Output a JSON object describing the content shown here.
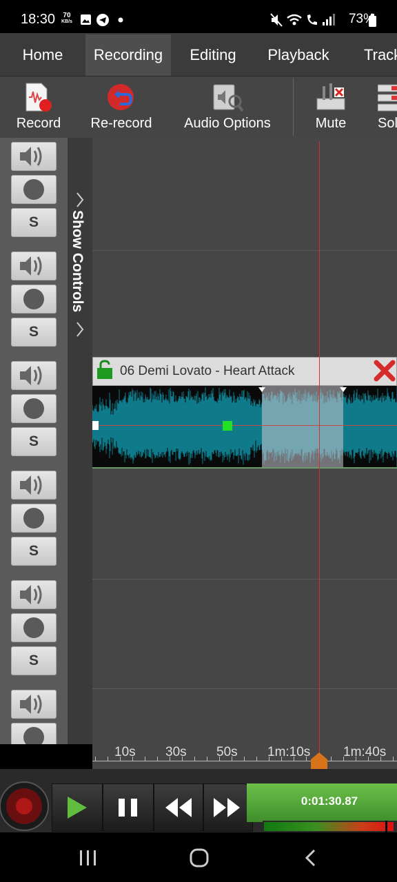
{
  "status_bar": {
    "time": "18:30",
    "speed_value": "70",
    "speed_unit": "KB/s",
    "battery": "73%",
    "icons": [
      "gallery-icon",
      "telegram-icon",
      "dot-icon",
      "mute-icon",
      "wifi-icon",
      "call-icon",
      "signal-icon",
      "battery-icon"
    ]
  },
  "tabs": [
    {
      "label": "Home",
      "active": false
    },
    {
      "label": "Recording",
      "active": true
    },
    {
      "label": "Editing",
      "active": false
    },
    {
      "label": "Playback",
      "active": false
    },
    {
      "label": "Track",
      "active": false
    }
  ],
  "toolbar": {
    "record": "Record",
    "rerecord": "Re-record",
    "audio_options": "Audio Options",
    "mute": "Mute",
    "solo": "Solo"
  },
  "track_controls": {
    "solo_letter": "S",
    "track_count": 6
  },
  "show_controls_label": "Show Controls",
  "clip": {
    "title": "06 Demi Lovato - Heart Attack",
    "locked": false
  },
  "ruler_ticks": [
    "10s",
    "30s",
    "50s",
    "1m:10s",
    "1m:40s"
  ],
  "transport": {
    "time": "0:01:30.87"
  },
  "colors": {
    "accent_green": "#5db23d",
    "wave_bg": "#0f7a8a",
    "playhead": "#cc3333",
    "marker": "#d9731a"
  }
}
